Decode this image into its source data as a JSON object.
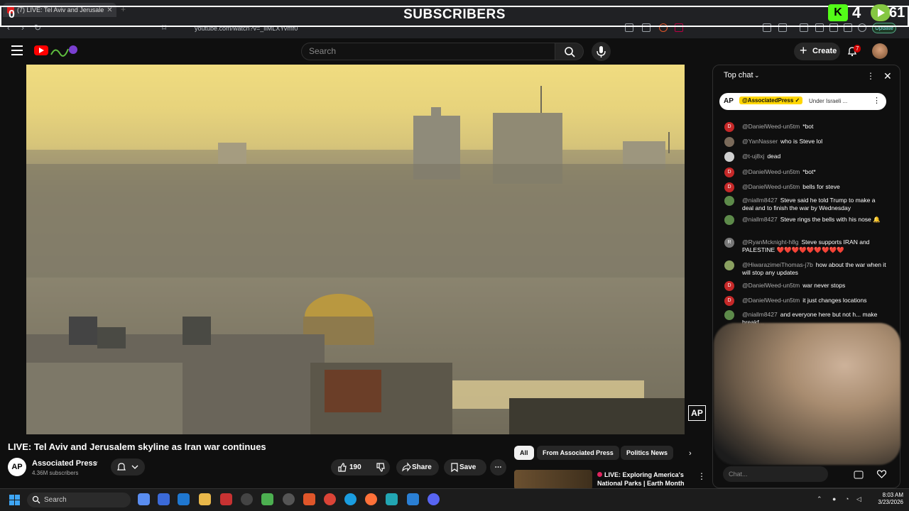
{
  "browser": {
    "tab_title": "(7) LIVE: Tel Aviv and Jerusale",
    "url": "youtube.com/watch?v=_iIMLXYvmf0",
    "update_label": "Update"
  },
  "stream_overlay": {
    "title": "SUBSCRIBERS",
    "left_count": "0",
    "kick_count": "4",
    "rumble_count": "61",
    "kick_letter": "K"
  },
  "youtube": {
    "search_placeholder": "Search",
    "create_label": "Create",
    "notification_count": "7"
  },
  "video": {
    "title": "LIVE: Tel Aviv and Jerusalem skyline as Iran war continues",
    "watermark": "AP",
    "channel": {
      "avatar_text": "AP",
      "name": "Associated Press",
      "subscribers": "4.36M subscribers"
    },
    "likes": "190",
    "share_label": "Share",
    "save_label": "Save"
  },
  "recommendations": {
    "chips": [
      "All",
      "From Associated Press",
      "Politics News"
    ],
    "item": {
      "title": "LIVE: Exploring America's National Parks | Earth Month ..."
    }
  },
  "chat": {
    "header": "Top chat",
    "pinned": {
      "avatar": "AP",
      "author": "@AssociatedPress ✓",
      "message": "Under Israeli ..."
    },
    "messages": [
      {
        "avatar": "D",
        "author": "@DanielWeed-un5tm",
        "text": "*bot",
        "color": "#c62828"
      },
      {
        "avatar": "",
        "author": "@YanNasser",
        "text": "who is Steve lol",
        "color": "#7a6a5a"
      },
      {
        "avatar": "",
        "author": "@t-uj8xj",
        "text": "dead",
        "color": "#cfcfcf"
      },
      {
        "avatar": "D",
        "author": "@DanielWeed-un5tm",
        "text": "*bot*",
        "color": "#c62828"
      },
      {
        "avatar": "D",
        "author": "@DanielWeed-un5tm",
        "text": "bells for steve",
        "color": "#c62828"
      },
      {
        "avatar": "",
        "author": "@niallm8427",
        "text": "Steve said he told Trump to make a deal and to finish the war by Wednesday",
        "color": "#5d8a4a"
      },
      {
        "avatar": "",
        "author": "@niallm8427",
        "text": "Steve rings the bells with his nose 🔔",
        "color": "#5d8a4a"
      },
      {
        "avatar": "R",
        "author": "@RyanMcknight-h8g",
        "text": "Steve supports IRAN and PALESTINE ❤️❤️❤️❤️❤️❤️❤️❤️❤️",
        "color": "#777"
      },
      {
        "avatar": "",
        "author": "@HiwarazimeiThomas-j7b",
        "text": "how about the war when it will stop any updates",
        "color": "#8aa060"
      },
      {
        "avatar": "D",
        "author": "@DanielWeed-un5tm",
        "text": "war never stops",
        "color": "#c62828"
      },
      {
        "avatar": "D",
        "author": "@DanielWeed-un5tm",
        "text": "it just changes locations",
        "color": "#c62828"
      },
      {
        "avatar": "",
        "author": "@niallm8427",
        "text": "and everyone here but not h... make breakf...",
        "color": "#5d8a4a"
      }
    ],
    "input_placeholder": "Chat..."
  },
  "taskbar": {
    "search_label": "Search",
    "time": "8:03 AM",
    "date": "3/23/2026"
  }
}
